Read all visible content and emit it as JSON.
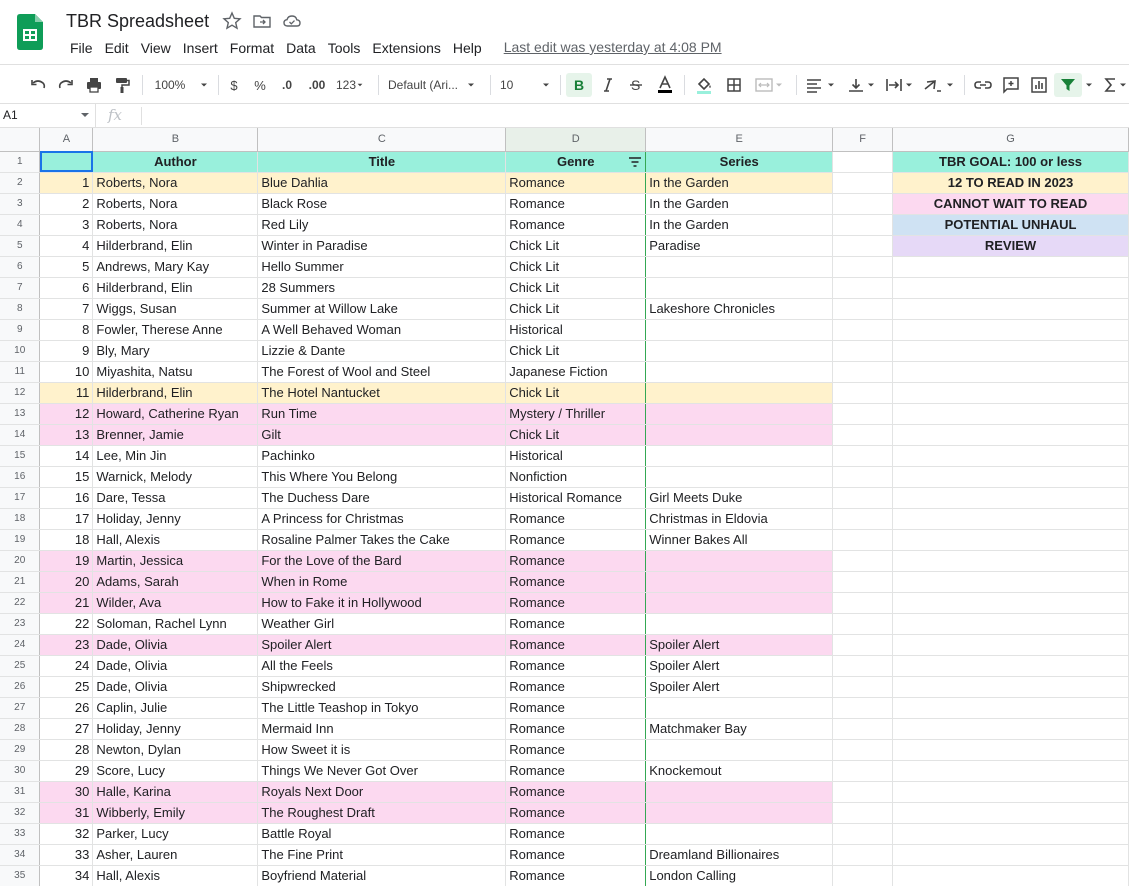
{
  "app": {
    "doc_title": "TBR Spreadsheet",
    "menu": [
      "File",
      "Edit",
      "View",
      "Insert",
      "Format",
      "Data",
      "Tools",
      "Extensions",
      "Help"
    ],
    "last_edit": "Last edit was yesterday at 4:08 PM"
  },
  "toolbar": {
    "zoom": "100%",
    "currency": "$",
    "percent": "%",
    "dec_decrease": ".0",
    "dec_increase": ".00",
    "more_formats": "123",
    "font": "Default (Ari...",
    "font_size": "10"
  },
  "formula_bar": {
    "cell_ref": "A1",
    "fx": "fx",
    "value": ""
  },
  "columns": [
    "A",
    "B",
    "C",
    "D",
    "E",
    "F",
    "G"
  ],
  "header_row": {
    "row_num": "1",
    "a": "",
    "author": "Author",
    "title": "Title",
    "genre": "Genre",
    "series": "Series",
    "f": "",
    "g": "TBR GOAL: 100 or less"
  },
  "legend": [
    {
      "label": "12 TO READ IN 2023",
      "color": "#fff2cc"
    },
    {
      "label": "CANNOT WAIT TO READ",
      "color": "#fcd9f0"
    },
    {
      "label": "POTENTIAL UNHAUL",
      "color": "#cfe2f3"
    },
    {
      "label": "REVIEW",
      "color": "#e6d9f7"
    }
  ],
  "rows": [
    {
      "r": "2",
      "n": "1",
      "author": "Roberts, Nora",
      "title": "Blue Dahlia",
      "genre": "Romance",
      "series": "In the Garden",
      "hl": "yellow"
    },
    {
      "r": "3",
      "n": "2",
      "author": "Roberts, Nora",
      "title": "Black Rose",
      "genre": "Romance",
      "series": "In the Garden",
      "hl": ""
    },
    {
      "r": "4",
      "n": "3",
      "author": "Roberts, Nora",
      "title": "Red Lily",
      "genre": "Romance",
      "series": "In the Garden",
      "hl": ""
    },
    {
      "r": "5",
      "n": "4",
      "author": "Hilderbrand, Elin",
      "title": "Winter in Paradise",
      "genre": "Chick Lit",
      "series": "Paradise",
      "hl": ""
    },
    {
      "r": "6",
      "n": "5",
      "author": "Andrews, Mary Kay",
      "title": "Hello Summer",
      "genre": "Chick Lit",
      "series": "",
      "hl": ""
    },
    {
      "r": "7",
      "n": "6",
      "author": "Hilderbrand, Elin",
      "title": "28 Summers",
      "genre": "Chick Lit",
      "series": "",
      "hl": ""
    },
    {
      "r": "8",
      "n": "7",
      "author": "Wiggs, Susan",
      "title": "Summer at Willow Lake",
      "genre": "Chick Lit",
      "series": "Lakeshore Chronicles",
      "hl": ""
    },
    {
      "r": "9",
      "n": "8",
      "author": "Fowler, Therese Anne",
      "title": "A Well Behaved Woman",
      "genre": "Historical",
      "series": "",
      "hl": ""
    },
    {
      "r": "10",
      "n": "9",
      "author": "Bly, Mary",
      "title": "Lizzie & Dante",
      "genre": "Chick Lit",
      "series": "",
      "hl": ""
    },
    {
      "r": "11",
      "n": "10",
      "author": "Miyashita, Natsu",
      "title": "The Forest of Wool and Steel",
      "genre": "Japanese Fiction",
      "series": "",
      "hl": ""
    },
    {
      "r": "12",
      "n": "11",
      "author": "Hilderbrand, Elin",
      "title": "The Hotel Nantucket",
      "genre": "Chick Lit",
      "series": "",
      "hl": "yellow"
    },
    {
      "r": "13",
      "n": "12",
      "author": "Howard, Catherine Ryan",
      "title": "Run Time",
      "genre": "Mystery / Thriller",
      "series": "",
      "hl": "pink"
    },
    {
      "r": "14",
      "n": "13",
      "author": "Brenner, Jamie",
      "title": "Gilt",
      "genre": "Chick Lit",
      "series": "",
      "hl": "pink"
    },
    {
      "r": "15",
      "n": "14",
      "author": "Lee, Min Jin",
      "title": "Pachinko",
      "genre": "Historical",
      "series": "",
      "hl": ""
    },
    {
      "r": "16",
      "n": "15",
      "author": "Warnick, Melody",
      "title": "This Where You Belong",
      "genre": "Nonfiction",
      "series": "",
      "hl": ""
    },
    {
      "r": "17",
      "n": "16",
      "author": "Dare, Tessa",
      "title": "The Duchess Dare",
      "genre": "Historical Romance",
      "series": "Girl Meets Duke",
      "hl": ""
    },
    {
      "r": "18",
      "n": "17",
      "author": "Holiday, Jenny",
      "title": "A Princess for Christmas",
      "genre": "Romance",
      "series": "Christmas in Eldovia",
      "hl": ""
    },
    {
      "r": "19",
      "n": "18",
      "author": "Hall, Alexis",
      "title": "Rosaline Palmer Takes the Cake",
      "genre": "Romance",
      "series": "Winner Bakes All",
      "hl": ""
    },
    {
      "r": "20",
      "n": "19",
      "author": "Martin, Jessica",
      "title": "For the Love of the Bard",
      "genre": "Romance",
      "series": "",
      "hl": "pink"
    },
    {
      "r": "21",
      "n": "20",
      "author": "Adams, Sarah",
      "title": "When in Rome",
      "genre": "Romance",
      "series": "",
      "hl": "pink"
    },
    {
      "r": "22",
      "n": "21",
      "author": "Wilder, Ava",
      "title": "How to Fake it in Hollywood",
      "genre": "Romance",
      "series": "",
      "hl": "pink"
    },
    {
      "r": "23",
      "n": "22",
      "author": "Soloman, Rachel Lynn",
      "title": "Weather Girl",
      "genre": "Romance",
      "series": "",
      "hl": ""
    },
    {
      "r": "24",
      "n": "23",
      "author": "Dade, Olivia",
      "title": "Spoiler Alert",
      "genre": "Romance",
      "series": "Spoiler Alert",
      "hl": "pink"
    },
    {
      "r": "25",
      "n": "24",
      "author": "Dade, Olivia",
      "title": "All the Feels",
      "genre": "Romance",
      "series": "Spoiler Alert",
      "hl": ""
    },
    {
      "r": "26",
      "n": "25",
      "author": "Dade, Olivia",
      "title": "Shipwrecked",
      "genre": "Romance",
      "series": "Spoiler Alert",
      "hl": ""
    },
    {
      "r": "27",
      "n": "26",
      "author": "Caplin, Julie",
      "title": "The Little Teashop in Tokyo",
      "genre": "Romance",
      "series": "",
      "hl": ""
    },
    {
      "r": "28",
      "n": "27",
      "author": "Holiday, Jenny",
      "title": "Mermaid Inn",
      "genre": "Romance",
      "series": "Matchmaker Bay",
      "hl": ""
    },
    {
      "r": "29",
      "n": "28",
      "author": "Newton, Dylan",
      "title": "How Sweet it is",
      "genre": "Romance",
      "series": "",
      "hl": ""
    },
    {
      "r": "30",
      "n": "29",
      "author": "Score, Lucy",
      "title": "Things We Never Got Over",
      "genre": "Romance",
      "series": "Knockemout",
      "hl": ""
    },
    {
      "r": "31",
      "n": "30",
      "author": "Halle, Karina",
      "title": "Royals Next Door",
      "genre": "Romance",
      "series": "",
      "hl": "pink"
    },
    {
      "r": "32",
      "n": "31",
      "author": "Wibberly, Emily",
      "title": "The Roughest Draft",
      "genre": "Romance",
      "series": "",
      "hl": "pink"
    },
    {
      "r": "33",
      "n": "32",
      "author": "Parker, Lucy",
      "title": "Battle Royal",
      "genre": "Romance",
      "series": "",
      "hl": ""
    },
    {
      "r": "34",
      "n": "33",
      "author": "Asher, Lauren",
      "title": "The Fine Print",
      "genre": "Romance",
      "series": "Dreamland Billionaires",
      "hl": ""
    },
    {
      "r": "35",
      "n": "34",
      "author": "Hall, Alexis",
      "title": "Boyfriend Material",
      "genre": "Romance",
      "series": "London Calling",
      "hl": ""
    }
  ],
  "colors": {
    "header_teal": "#99f0dc",
    "yellow": "#fff2cc",
    "pink": "#fcd9f0",
    "blue": "#cfe2f3",
    "purple": "#e6d9f7",
    "sheets_green": "#0f9d58"
  }
}
